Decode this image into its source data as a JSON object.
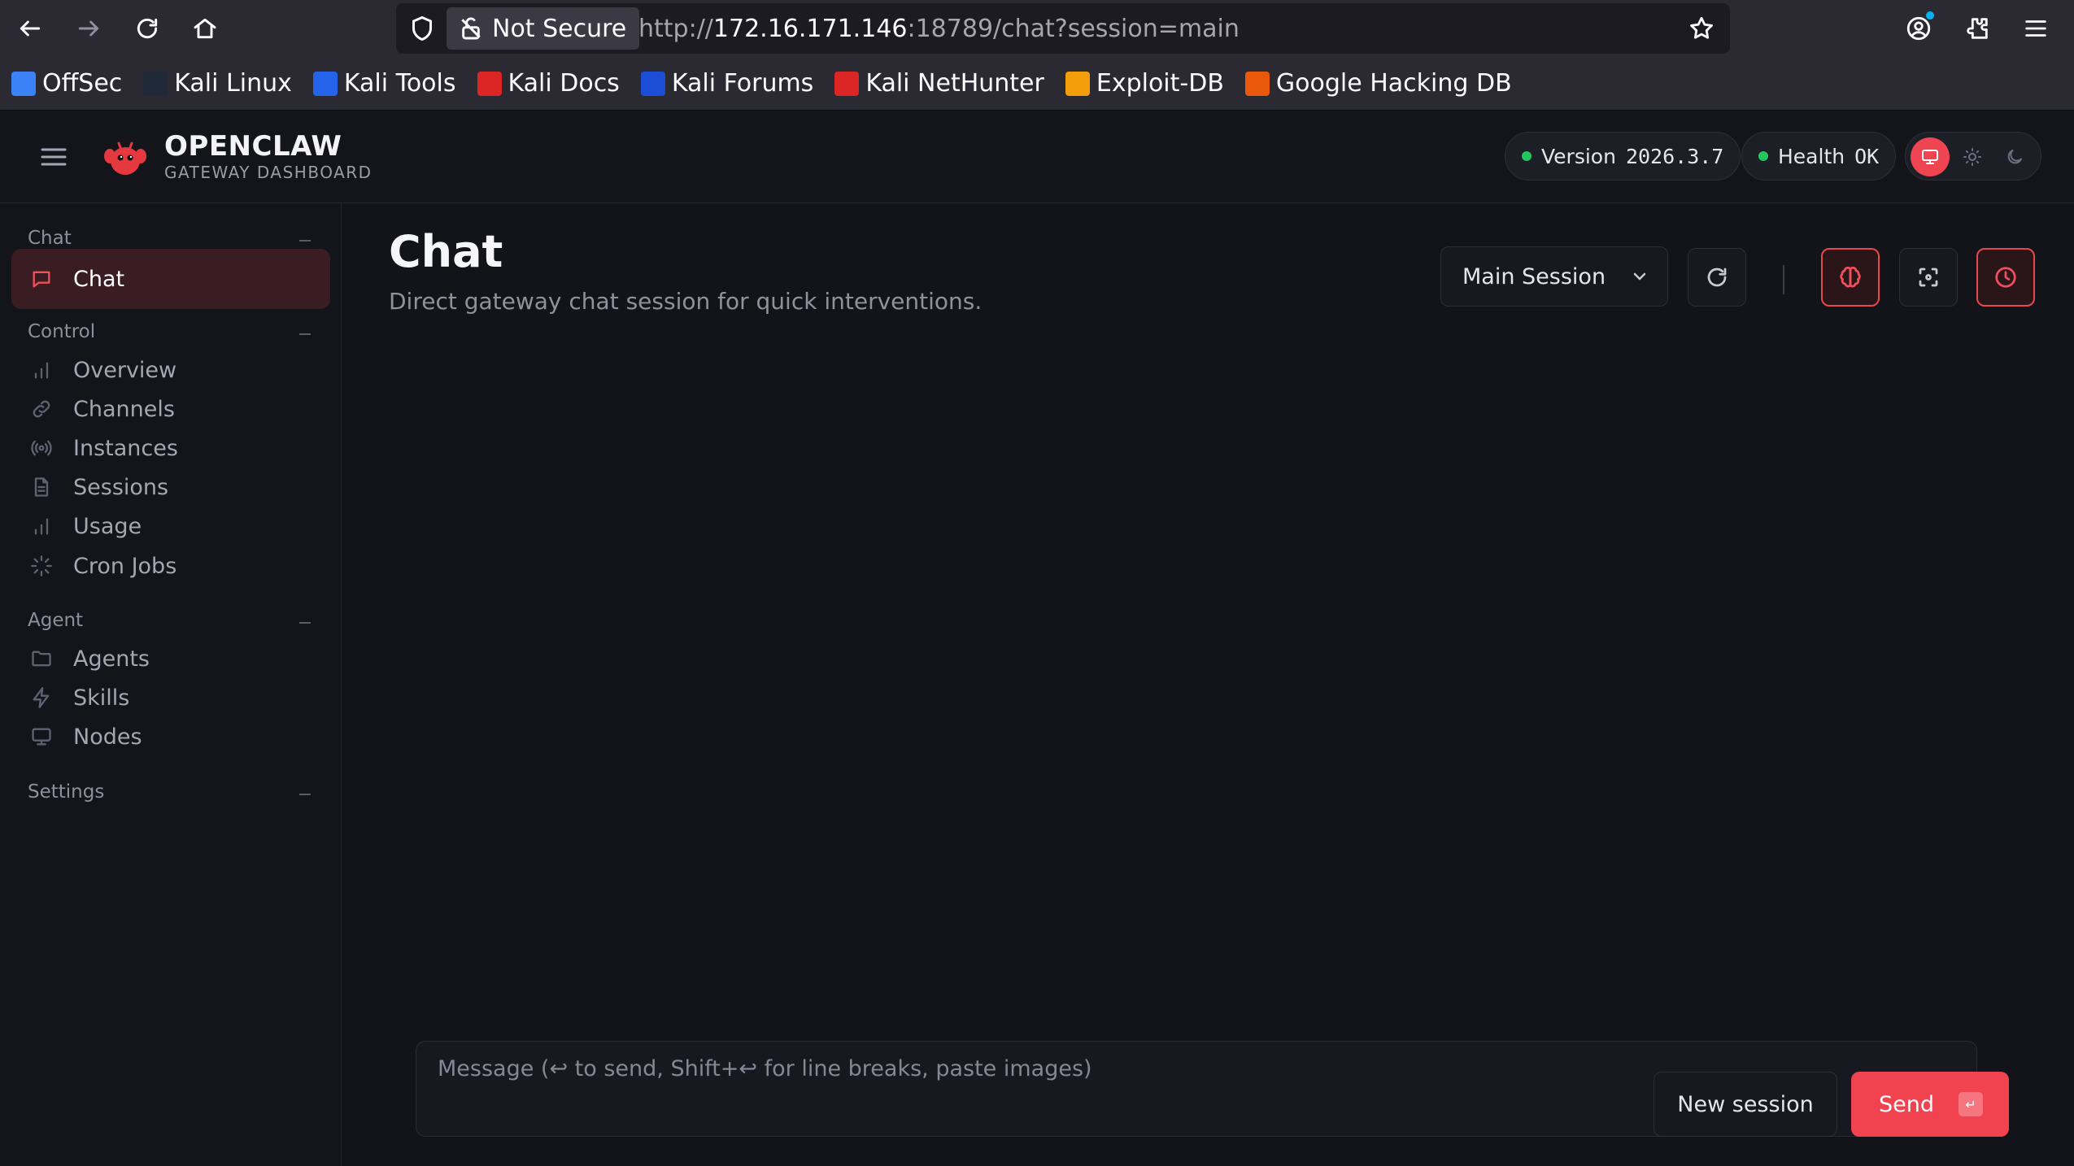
{
  "browser": {
    "security_label": "Not Secure",
    "url_scheme": "http://",
    "url_host": "172.16.171.146",
    "url_rest": ":18789/chat?session=main",
    "bookmarks": [
      {
        "label": "OffSec",
        "icon": "offsec-icon",
        "color": "#3b82f6"
      },
      {
        "label": "Kali Linux",
        "icon": "kali-dragon-icon",
        "color": "#1f2937"
      },
      {
        "label": "Kali Tools",
        "icon": "kali-tools-icon",
        "color": "#2563eb"
      },
      {
        "label": "Kali Docs",
        "icon": "kali-docs-icon",
        "color": "#dc2626"
      },
      {
        "label": "Kali Forums",
        "icon": "kali-forums-icon",
        "color": "#1d4ed8"
      },
      {
        "label": "Kali NetHunter",
        "icon": "nethunter-icon",
        "color": "#dc2626"
      },
      {
        "label": "Exploit-DB",
        "icon": "exploit-db-icon",
        "color": "#f59e0b"
      },
      {
        "label": "Google Hacking DB",
        "icon": "ghdb-icon",
        "color": "#ea580c"
      }
    ]
  },
  "header": {
    "brand_title": "OPENCLAW",
    "brand_subtitle": "GATEWAY DASHBOARD",
    "version_label": "Version",
    "version_value": "2026.3.7",
    "health_label": "Health",
    "health_value": "OK",
    "status_color": "#22c55e",
    "accent_color": "#ef4452"
  },
  "sidebar": {
    "groups": [
      {
        "title": "Chat",
        "items": [
          {
            "label": "Chat",
            "icon": "chat-bubble-icon",
            "active": true
          }
        ]
      },
      {
        "title": "Control",
        "items": [
          {
            "label": "Overview",
            "icon": "bar-chart-icon"
          },
          {
            "label": "Channels",
            "icon": "link-icon"
          },
          {
            "label": "Instances",
            "icon": "broadcast-icon"
          },
          {
            "label": "Sessions",
            "icon": "document-icon"
          },
          {
            "label": "Usage",
            "icon": "bar-chart-icon"
          },
          {
            "label": "Cron Jobs",
            "icon": "loader-icon"
          }
        ]
      },
      {
        "title": "Agent",
        "items": [
          {
            "label": "Agents",
            "icon": "folder-icon"
          },
          {
            "label": "Skills",
            "icon": "lightning-icon"
          },
          {
            "label": "Nodes",
            "icon": "monitor-icon"
          }
        ]
      },
      {
        "title": "Settings",
        "items": []
      }
    ]
  },
  "main": {
    "title": "Chat",
    "subtitle": "Direct gateway chat session for quick interventions.",
    "session_select": "Main Session",
    "composer_placeholder": "Message (↩ to send, Shift+↩ for line breaks, paste images)",
    "new_session_label": "New session",
    "send_label": "Send",
    "send_kbd": "↵"
  }
}
